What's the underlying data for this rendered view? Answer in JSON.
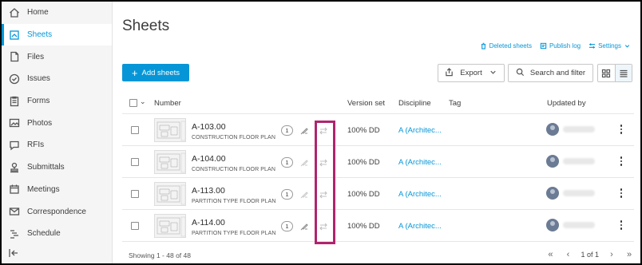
{
  "sidebar": {
    "items": [
      {
        "label": "Home",
        "icon": "home-icon"
      },
      {
        "label": "Sheets",
        "icon": "sheets-icon",
        "active": true
      },
      {
        "label": "Files",
        "icon": "file-icon"
      },
      {
        "label": "Issues",
        "icon": "issues-icon"
      },
      {
        "label": "Forms",
        "icon": "forms-icon"
      },
      {
        "label": "Photos",
        "icon": "photos-icon"
      },
      {
        "label": "RFIs",
        "icon": "rfi-icon"
      },
      {
        "label": "Submittals",
        "icon": "submittals-icon"
      },
      {
        "label": "Meetings",
        "icon": "calendar-icon"
      },
      {
        "label": "Correspondence",
        "icon": "mail-icon"
      },
      {
        "label": "Schedule",
        "icon": "schedule-icon"
      }
    ]
  },
  "header": {
    "title": "Sheets",
    "links": {
      "deleted": "Deleted sheets",
      "publish_log": "Publish log",
      "settings": "Settings"
    }
  },
  "toolbar": {
    "add_label": "Add sheets",
    "export_label": "Export",
    "search_label": "Search and filter"
  },
  "table": {
    "columns": {
      "number": "Number",
      "version_set": "Version set",
      "discipline": "Discipline",
      "tag": "Tag",
      "updated_by": "Updated by"
    },
    "rows": [
      {
        "number": "A-103.00",
        "title": "CONSTRUCTION FLOOR PLAN",
        "version": "1",
        "version_set": "100% DD",
        "discipline": "A (Architec..."
      },
      {
        "number": "A-104.00",
        "title": "CONSTRUCTION FLOOR PLAN",
        "version": "1",
        "version_set": "100% DD",
        "discipline": "A (Architec..."
      },
      {
        "number": "A-113.00",
        "title": "PARTITION TYPE FLOOR PLAN",
        "version": "1",
        "version_set": "100% DD",
        "discipline": "A (Architec..."
      },
      {
        "number": "A-114.00",
        "title": "PARTITION TYPE FLOOR PLAN",
        "version": "1",
        "version_set": "100% DD",
        "discipline": "A (Architec..."
      }
    ]
  },
  "footer": {
    "showing": "Showing 1 - 48 of 48",
    "page": "1",
    "of": "of 1"
  },
  "colors": {
    "accent": "#0696d7",
    "highlight": "#b0246e"
  }
}
